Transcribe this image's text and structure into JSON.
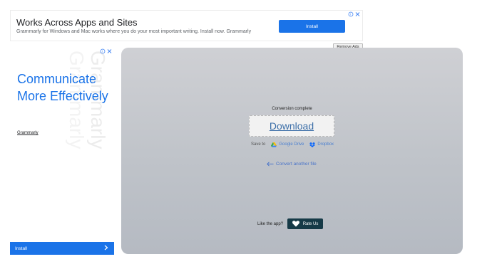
{
  "top_ad": {
    "title": "Works Across Apps and Sites",
    "description": "Grammarly for Windows and Mac works where you do your most important writing. Install now. Grammarly",
    "install_label": "Install"
  },
  "remove_ads_label": "Remove Ads",
  "left_ad": {
    "headline": "Communicate More Effectively",
    "brand": "Grammarly",
    "install_label": "Install",
    "watermark_text": "Grammarly"
  },
  "conversion": {
    "status": "Conversion complete",
    "download_label": "Download",
    "save_to_label": "Save to",
    "google_drive_label": "Google Drive",
    "dropbox_label": "Dropbox",
    "convert_another_label": "Convert another file",
    "like_app_label": "Like the app?",
    "rate_us_label": "Rate Us"
  },
  "colors": {
    "accent": "#1a73e8",
    "download_link": "#3d6fa8",
    "rate_button_bg": "#163a47"
  }
}
